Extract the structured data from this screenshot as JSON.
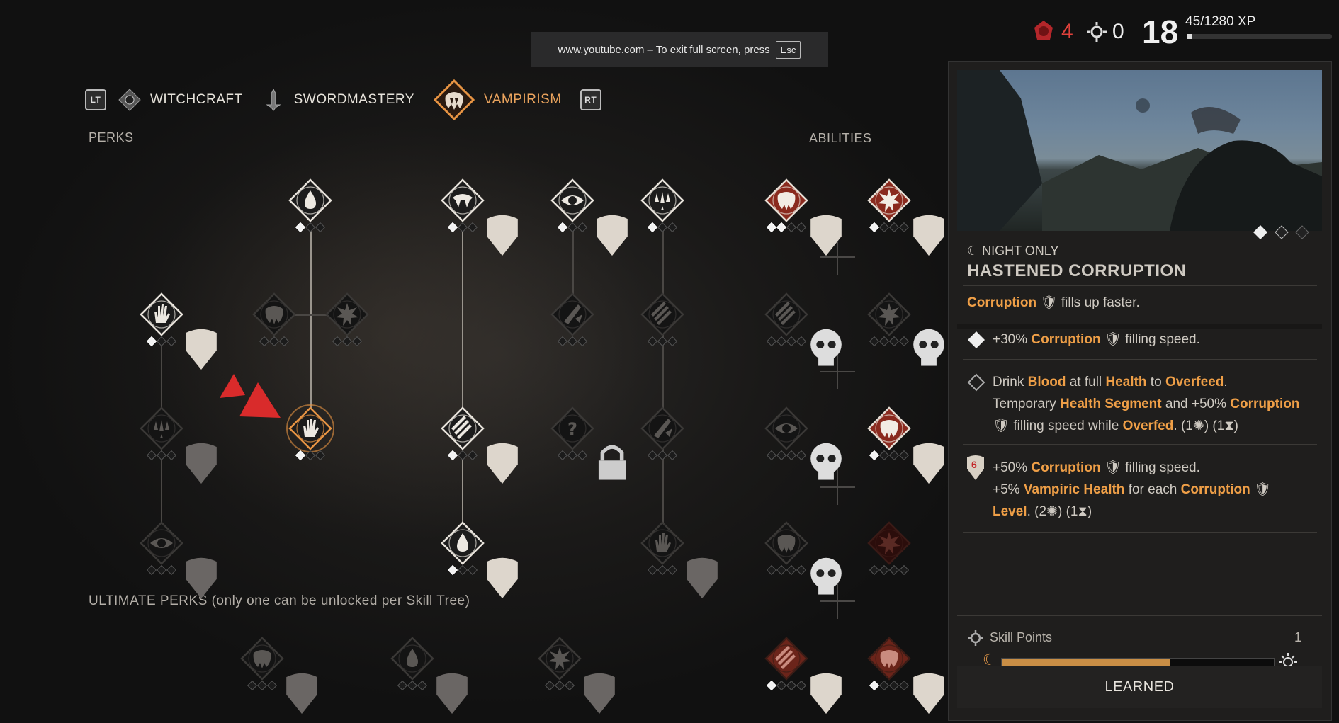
{
  "notice": {
    "text": "www.youtube.com – To exit full screen, press",
    "key": "Esc"
  },
  "hud": {
    "blood_count": "4",
    "sun_count": "0",
    "level": "18",
    "xp": "45/1280 XP",
    "xp_progress": 0.035
  },
  "tabs": {
    "left_key": "LT",
    "right_key": "RT",
    "items": [
      {
        "label": "WITCHCRAFT",
        "active": false
      },
      {
        "label": "SWORDMASTERY",
        "active": false
      },
      {
        "label": "VAMPIRISM",
        "active": true
      }
    ]
  },
  "sections": {
    "perks": "PERKS",
    "abilities": "ABILITIES",
    "ultimate": "ULTIMATE PERKS (only one can be unlocked per Skill Tree)"
  },
  "panel": {
    "tag": "☾ NIGHT ONLY",
    "title": "HASTENED CORRUPTION",
    "summary_hl": "Corruption",
    "summary_rest": "fills up faster.",
    "tier1": {
      "pre": "+30%",
      "hl": "Corruption",
      "post": "filling speed."
    },
    "tier2": {
      "l1a": "Drink",
      "l1b": "Blood",
      "l1c": "at full",
      "l1d": "Health",
      "l1e": "to",
      "l1f": "Overfeed",
      "l2a": "Temporary",
      "l2b": "Health Segment",
      "l2c": "and +50%",
      "l2d": "Corruption",
      "l3a": "filling speed while",
      "l3b": "Overfed",
      "l3c": "(1",
      "l3d": ") (1",
      "l3e": ")"
    },
    "tier3": {
      "badge": "6",
      "l1a": "+50%",
      "l1b": "Corruption",
      "l1c": "filling speed.",
      "l2a": "+5%",
      "l2b": "Vampiric Health",
      "l2c": "for each",
      "l2d": "Corruption",
      "l3a": "Level",
      "l3b": ". (2",
      "l3c": ") (1",
      "l3d": ")"
    },
    "skill_points_label": "Skill Points",
    "skill_points_value": "1",
    "learned_label": "LEARNED",
    "day_night_progress": 0.62
  },
  "colors": {
    "accent": "#ea9b4a",
    "red": "#e0413b"
  }
}
